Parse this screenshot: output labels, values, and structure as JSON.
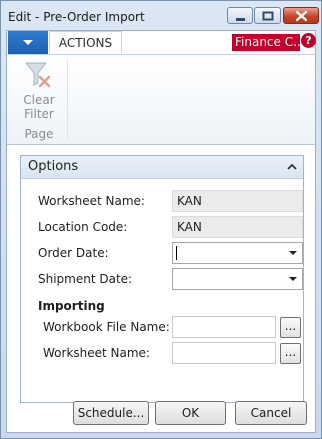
{
  "window": {
    "title": "Edit - Pre-Order Import",
    "controls": {
      "minimize": "minimize-icon",
      "maximize": "maximize-icon",
      "close": "close-icon"
    }
  },
  "ribbon": {
    "tab_actions": "ACTIONS",
    "company": "Finance C...",
    "help_symbol": "?",
    "clear_filter": "Clear Filter",
    "group_label": "Page"
  },
  "options": {
    "title": "Options",
    "worksheet_name_label": "Worksheet Name:",
    "worksheet_name_value": "KAN",
    "location_code_label": "Location Code:",
    "location_code_value": "KAN",
    "order_date_label": "Order Date:",
    "order_date_value": "",
    "shipment_date_label": "Shipment Date:",
    "shipment_date_value": "",
    "importing_label": "Importing",
    "workbook_file_label": "Workbook File Name:",
    "workbook_file_value": "",
    "import_worksheet_label": "Worksheet Name:",
    "import_worksheet_value": "",
    "browse_label": "..."
  },
  "buttons": {
    "schedule": "Schedule...",
    "ok": "OK",
    "cancel": "Cancel"
  },
  "colors": {
    "accent_blue": "#1d5fae",
    "company_badge": "#c0002a",
    "close_button": "#c7442a"
  }
}
